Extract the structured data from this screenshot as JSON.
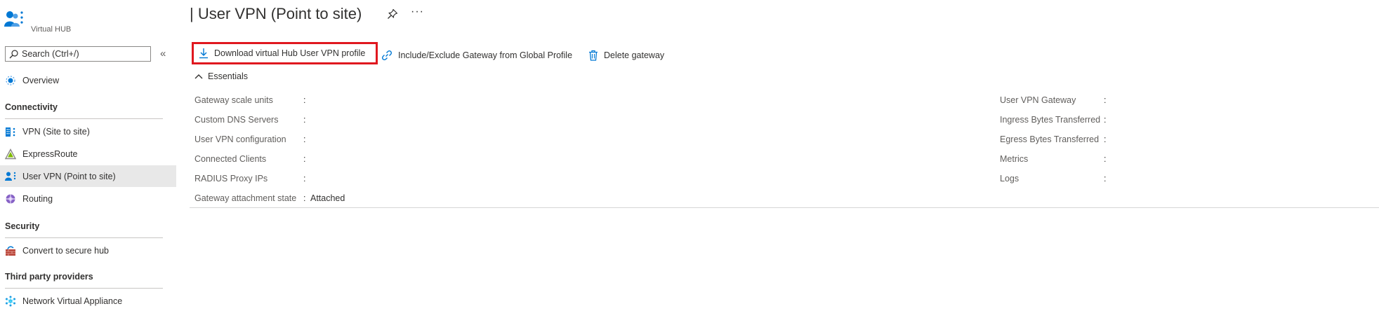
{
  "sidebar": {
    "resource_type": "Virtual HUB",
    "search": {
      "placeholder": "Search (Ctrl+/)",
      "value": ""
    },
    "collapse_glyph": "«",
    "items": [
      {
        "label": "Overview",
        "icon": "overview-icon"
      },
      {
        "label": "VPN (Site to site)",
        "icon": "vpn-site-icon"
      },
      {
        "label": "ExpressRoute",
        "icon": "expressroute-icon"
      },
      {
        "label": "User VPN (Point to site)",
        "icon": "user-vpn-icon",
        "selected": true
      },
      {
        "label": "Routing",
        "icon": "routing-icon"
      },
      {
        "label": "Convert to secure hub",
        "icon": "firewall-icon"
      },
      {
        "label": "Network Virtual Appliance",
        "icon": "nva-icon"
      }
    ],
    "sections": {
      "connectivity": "Connectivity",
      "security": "Security",
      "third_party": "Third party providers"
    }
  },
  "header": {
    "title": "| User VPN (Point to site)",
    "more_glyph": "···"
  },
  "toolbar": {
    "download_label": "Download virtual Hub User VPN profile",
    "include_exclude_label": "Include/Exclude Gateway from Global Profile",
    "delete_label": "Delete gateway"
  },
  "essentials": {
    "toggle_label": "Essentials",
    "left": [
      {
        "label": "Gateway scale units",
        "value": ""
      },
      {
        "label": "Custom DNS Servers",
        "value": ""
      },
      {
        "label": "User VPN configuration",
        "value": ""
      },
      {
        "label": "Connected Clients",
        "value": ""
      },
      {
        "label": "RADIUS Proxy IPs",
        "value": ""
      },
      {
        "label": "Gateway attachment state",
        "value": "Attached"
      }
    ],
    "right": [
      {
        "label": "User VPN Gateway",
        "value": ""
      },
      {
        "label": "Ingress Bytes Transferred",
        "value": ""
      },
      {
        "label": "Egress Bytes Transferred",
        "value": ""
      },
      {
        "label": "Metrics",
        "value": ""
      },
      {
        "label": "Logs",
        "value": ""
      }
    ],
    "colon": ":"
  },
  "colors": {
    "accent": "#0078d4",
    "highlight_border": "#e0181f",
    "selected_bg": "#e8e8e8"
  }
}
